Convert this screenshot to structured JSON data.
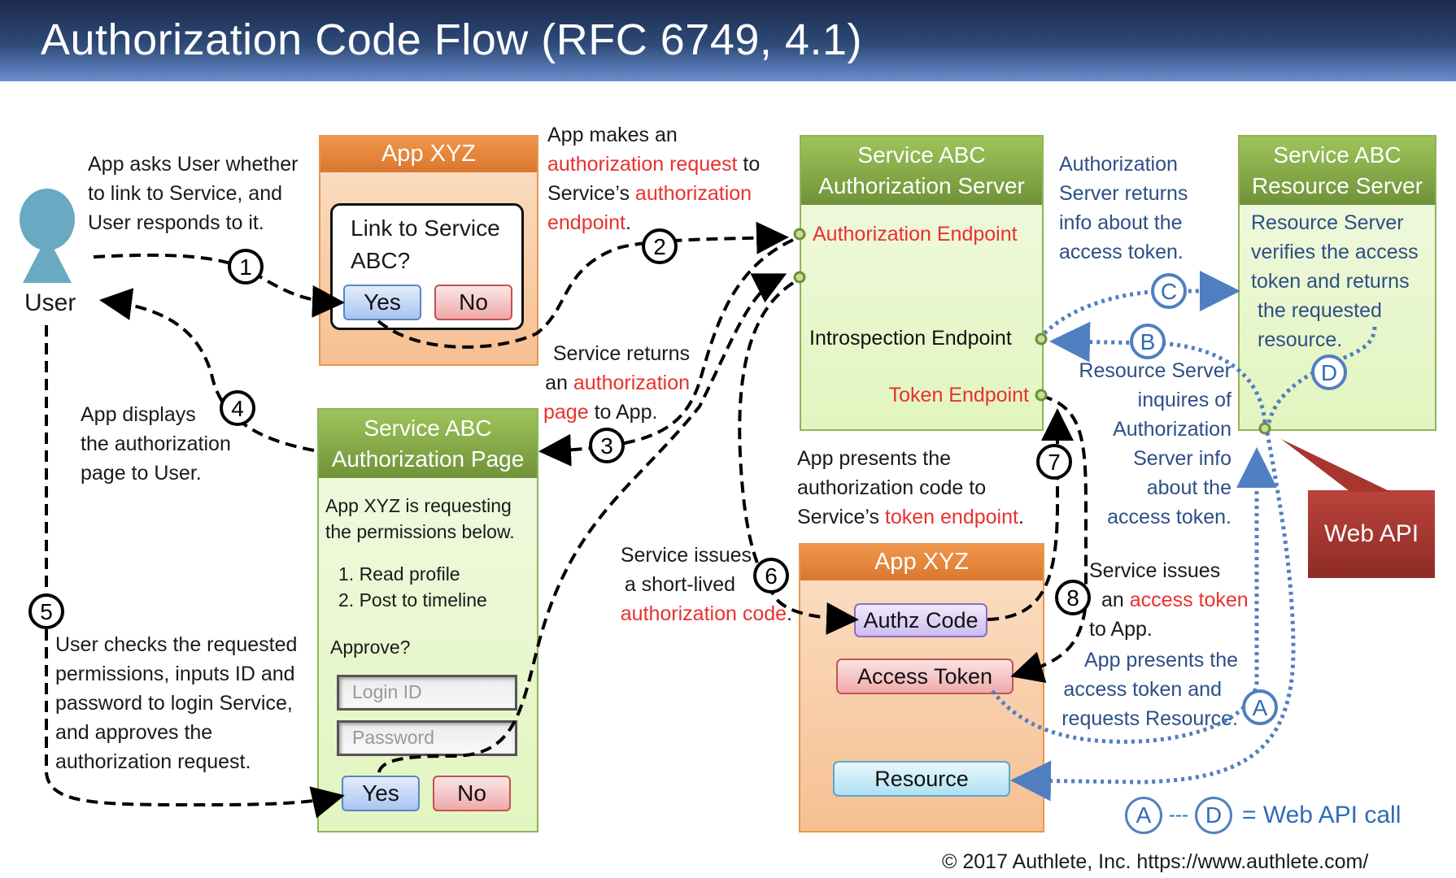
{
  "title": "Authorization Code Flow   (RFC 6749, 4.1)",
  "user": {
    "label": "User"
  },
  "app_top": {
    "header": "App XYZ",
    "dialog_question_line1": "Link to Service",
    "dialog_question_line2": "ABC?",
    "yes_label": "Yes",
    "no_label": "No"
  },
  "auth_page": {
    "header_line1": "Service ABC",
    "header_line2": "Authorization Page",
    "intro_line1": "App XYZ is requesting",
    "intro_line2": "the permissions below.",
    "permissions": [
      "1. Read profile",
      "2. Post to timeline"
    ],
    "approve_label": "Approve?",
    "login_placeholder": "Login ID",
    "password_placeholder": "Password",
    "yes_label": "Yes",
    "no_label": "No"
  },
  "auth_server": {
    "header_line1": "Service ABC",
    "header_line2": "Authorization Server",
    "authorization_endpoint": "Authorization Endpoint",
    "introspection_endpoint": "Introspection Endpoint",
    "token_endpoint": "Token Endpoint"
  },
  "resource_server": {
    "header_line1": "Service ABC",
    "header_line2": "Resource Server",
    "desc": [
      "Resource Server",
      "verifies the access",
      "token and returns",
      "the requested",
      "resource."
    ]
  },
  "app_bottom": {
    "header": "App XYZ",
    "authz_code": "Authz Code",
    "access_token": "Access Token",
    "resource": "Resource"
  },
  "web_api_callout": "Web API",
  "steps": {
    "s1": {
      "num": "1",
      "lines": [
        "App asks User whether",
        "to link to Service, and",
        "User responds to it."
      ]
    },
    "s2": {
      "num": "2",
      "l1": "App makes an",
      "l2_red": "authorization request",
      "l2_black": " to",
      "l3_black": "Service’s ",
      "l3_red": "authorization",
      "l4_red": "endpoint",
      "l4_black": "."
    },
    "s3": {
      "num": "3",
      "l1": "Service returns",
      "l2_black": "an ",
      "l2_red": "authorization",
      "l3_red": "page",
      "l3_black": " to App."
    },
    "s4": {
      "num": "4",
      "lines": [
        "App displays",
        "the authorization",
        "page to User."
      ]
    },
    "s5": {
      "num": "5",
      "lines": [
        "User checks the requested",
        "permissions, inputs ID and",
        "password to login Service,",
        "and approves the",
        "authorization request."
      ]
    },
    "s6": {
      "num": "6",
      "l1": "Service issues",
      "l2": "a short-lived",
      "l3_red": "authorization code",
      "l3_black": "."
    },
    "s7": {
      "num": "7",
      "l1": "App presents the",
      "l2": "authorization code to",
      "l3_black": "Service’s ",
      "l3_red": "token endpoint",
      "l3_end": "."
    },
    "s8": {
      "num": "8",
      "l1": "Service issues",
      "l2_black": "an ",
      "l2_red": "access token",
      "l3": "to App."
    }
  },
  "api_calls": {
    "A": {
      "label": "A",
      "lines": [
        "App presents the",
        "access token and",
        "requests Resource."
      ]
    },
    "B": {
      "label": "B",
      "lines": [
        "Resource Server",
        "inquires of",
        "Authorization",
        "Server info",
        "about the",
        "access token."
      ]
    },
    "C": {
      "label": "C",
      "lines": [
        "Authorization",
        "Server returns",
        "info about the",
        "access token."
      ]
    },
    "D": {
      "label": "D"
    }
  },
  "legend": {
    "from": "A",
    "sep": "---",
    "to": "D",
    "text": "= Web API call"
  },
  "footer": "© 2017 Authlete, Inc.  https://www.authlete.com/",
  "colors": {
    "accent_red": "#e8312f",
    "api_blue": "#4f7fc0",
    "title_bg": "#2e4a78",
    "callout_red": "#a8362f"
  }
}
